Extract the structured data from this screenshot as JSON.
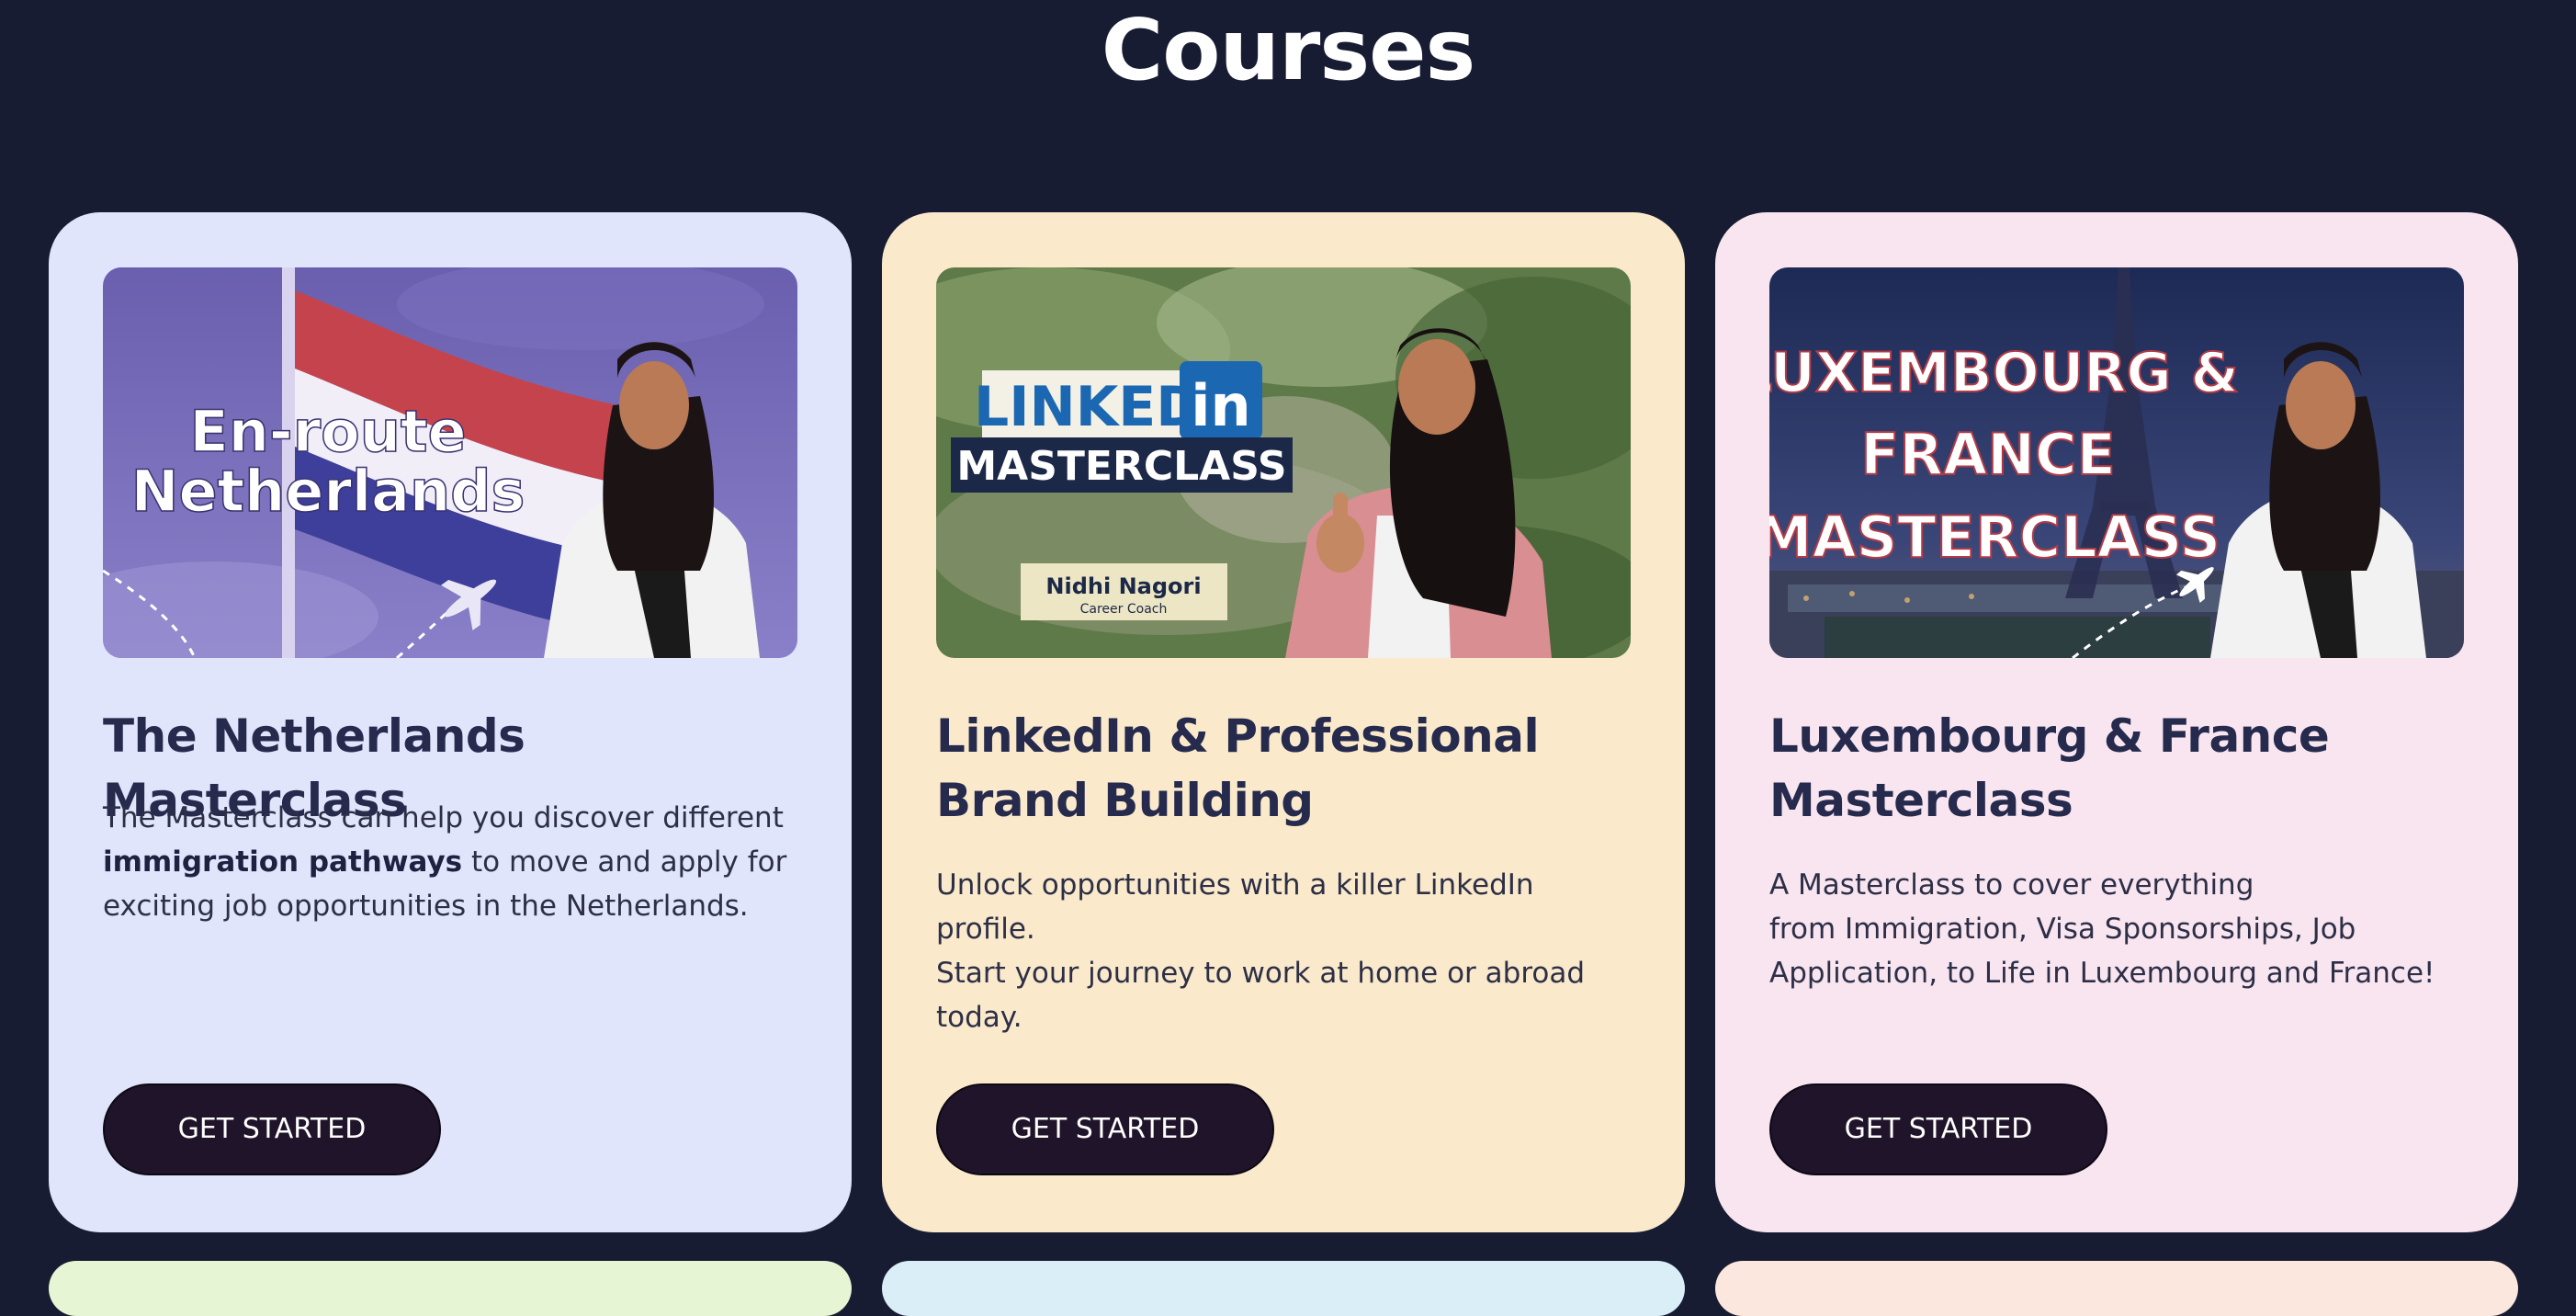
{
  "page": {
    "title": "Courses"
  },
  "courses": [
    {
      "image_text": [
        "En-route",
        "Netherlands"
      ],
      "title": "The Netherlands Masterclass",
      "description": {
        "before": "The Masterclass can help you discover different ",
        "bold": "immigration pathways",
        "after": " to move and apply for exciting job opportunities in the Netherlands."
      },
      "button": "GET STARTED",
      "bg_color": "#e0e5fb"
    },
    {
      "image_text": [
        "LINKED",
        "in",
        "MASTERCLASS",
        "Nidhi Nagori",
        "Career Coach"
      ],
      "title_lines": [
        "LinkedIn & Professional",
        "Brand Building"
      ],
      "description_lines": [
        "Unlock opportunities with a killer LinkedIn profile.",
        "Start your journey to work at home or abroad",
        "today."
      ],
      "button": "GET STARTED",
      "bg_color": "#faeacb"
    },
    {
      "image_text": [
        "LUXEMBOURG &",
        "FRANCE",
        "MASTERCLASS"
      ],
      "title_lines": [
        "Luxembourg & France",
        "Masterclass"
      ],
      "description_lines": [
        "A Masterclass to cover everything",
        "from Immigration, Visa Sponsorships, Job",
        "Application, to Life in Luxembourg and France!"
      ],
      "button": "GET STARTED",
      "bg_color": "#f8e5f0"
    }
  ],
  "colors": {
    "page_bg": "#181c33",
    "title_text": "#262a4d",
    "button_bg": "#20142a"
  }
}
